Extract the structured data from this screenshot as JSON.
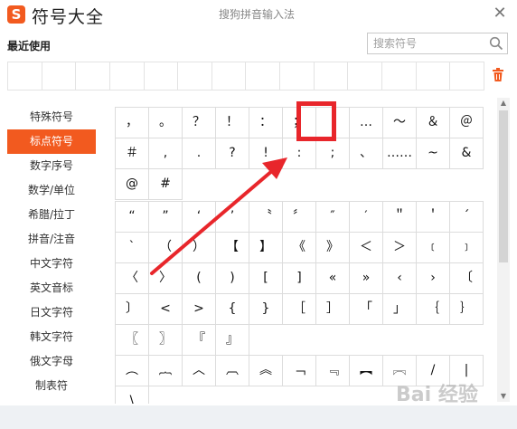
{
  "app": {
    "logo_letter": "S",
    "title": "符号大全",
    "subtitle": "搜狗拼音输入法",
    "close": "✕"
  },
  "recent": {
    "label": "最近使用",
    "cells": 14
  },
  "search": {
    "placeholder": "搜索符号",
    "value": ""
  },
  "sidebar": {
    "items": [
      {
        "label": "特殊符号",
        "active": false
      },
      {
        "label": "标点符号",
        "active": true
      },
      {
        "label": "数字序号",
        "active": false
      },
      {
        "label": "数学/单位",
        "active": false
      },
      {
        "label": "希腊/拉丁",
        "active": false
      },
      {
        "label": "拼音/注音",
        "active": false
      },
      {
        "label": "中文字符",
        "active": false
      },
      {
        "label": "英文音标",
        "active": false
      },
      {
        "label": "日文字符",
        "active": false
      },
      {
        "label": "韩文字符",
        "active": false
      },
      {
        "label": "俄文字母",
        "active": false
      },
      {
        "label": "制表符",
        "active": false
      }
    ]
  },
  "grid1": [
    "，",
    "。",
    "？",
    "！",
    "：",
    "；",
    "·",
    "…",
    "～",
    "＆",
    "＠",
    "＃",
    ",",
    ".",
    "?",
    "!",
    ":",
    ";",
    "、",
    "……",
    "~",
    "&",
    "@",
    "#"
  ],
  "grid2": [
    "“",
    "”",
    "‘",
    "’",
    "〝",
    "〞",
    "″",
    "′",
    "＂",
    "＇",
    "ˊ",
    "ˋ",
    "（",
    "）",
    "【",
    "】",
    "《",
    "》",
    "＜",
    "＞",
    "﹝",
    "﹞",
    "〈",
    "〉",
    "(",
    ")",
    "[",
    "]",
    "«",
    "»",
    "‹",
    "›",
    "〔",
    "〕",
    "<",
    ">",
    "{",
    "}",
    "［",
    "］",
    "「",
    "」",
    "｛",
    "｝",
    "〖",
    "〗",
    "『",
    "』"
  ],
  "grid3": [
    "︵",
    "︷",
    "︿",
    "︹",
    "︽",
    "﹁",
    "﹃",
    "︻",
    "︗",
    "/",
    "|",
    "\\"
  ],
  "watermark": "Bai 经验"
}
